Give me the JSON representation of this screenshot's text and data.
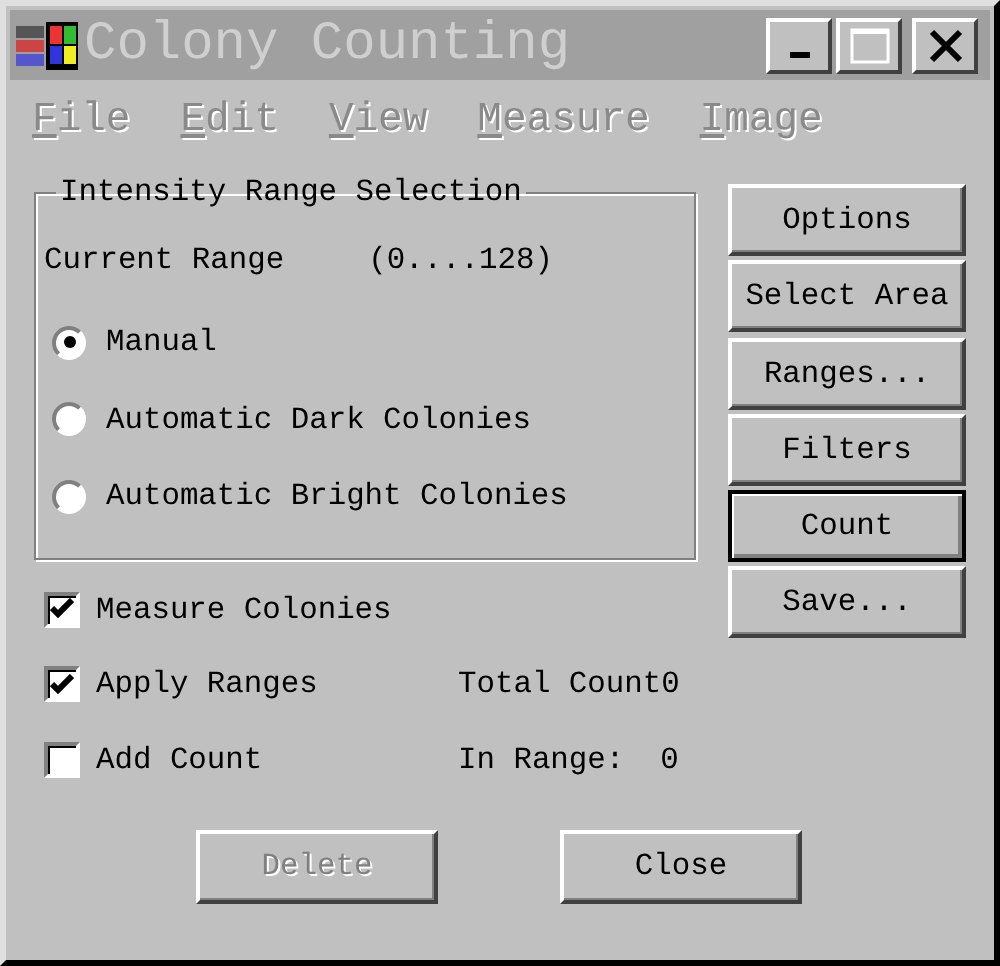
{
  "window": {
    "title": "Colony Counting",
    "active": false
  },
  "menu": [
    {
      "label": "File",
      "disabled": true
    },
    {
      "label": "Edit",
      "disabled": true
    },
    {
      "label": "View",
      "disabled": true
    },
    {
      "label": "Measure",
      "disabled": true
    },
    {
      "label": "Image",
      "disabled": true
    }
  ],
  "range_group": {
    "title": "Intensity Range Selection",
    "current_range_label": "Current Range",
    "current_range_value": "(0....128)",
    "options": [
      {
        "label": "Manual",
        "selected": true
      },
      {
        "label": "Automatic Dark Colonies",
        "selected": false
      },
      {
        "label": "Automatic Bright Colonies",
        "selected": false
      }
    ]
  },
  "side_buttons": [
    {
      "label": "Options",
      "default": false
    },
    {
      "label": "Select Area",
      "default": false
    },
    {
      "label": "Ranges...",
      "default": false
    },
    {
      "label": "Filters",
      "default": false
    },
    {
      "label": "Count",
      "default": true
    },
    {
      "label": "Save...",
      "default": false
    }
  ],
  "checkboxes": [
    {
      "label": "Measure Colonies",
      "checked": true
    },
    {
      "label": "Apply Ranges",
      "checked": true
    },
    {
      "label": "Add Count",
      "checked": false
    }
  ],
  "totals": [
    {
      "label": "Total Count",
      "value": "0"
    },
    {
      "label": "In Range:",
      "value": "0"
    }
  ],
  "buttons": [
    {
      "label": "Delete",
      "disabled": true
    },
    {
      "label": "Close",
      "disabled": false
    }
  ]
}
